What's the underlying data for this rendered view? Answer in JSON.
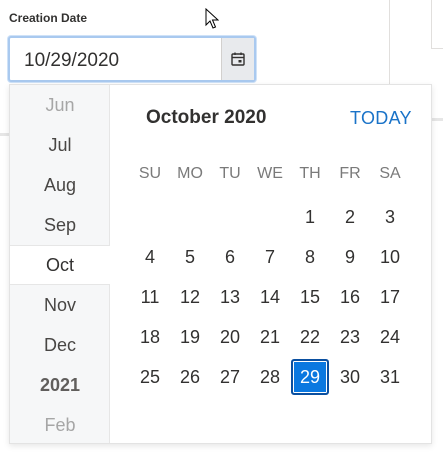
{
  "field": {
    "label": "Creation Date",
    "value": "10/29/2020",
    "button_icon": "calendar-icon"
  },
  "picker": {
    "month_strip": [
      {
        "label": "Jun",
        "state": "faded"
      },
      {
        "label": "Jul",
        "state": "normal"
      },
      {
        "label": "Aug",
        "state": "normal"
      },
      {
        "label": "Sep",
        "state": "normal"
      },
      {
        "label": "Oct",
        "state": "selected"
      },
      {
        "label": "Nov",
        "state": "normal"
      },
      {
        "label": "Dec",
        "state": "normal"
      },
      {
        "label": "2021",
        "state": "year"
      },
      {
        "label": "Feb",
        "state": "faded"
      }
    ],
    "title": "October 2020",
    "today_label": "TODAY",
    "weekdays": [
      "SU",
      "MO",
      "TU",
      "WE",
      "TH",
      "FR",
      "SA"
    ],
    "first_weekday_index": 4,
    "days_in_month": 31,
    "selected_day": 29
  },
  "colors": {
    "accent": "#0a78e0",
    "link": "#1a73c8",
    "focus_border": "#a9c9ef"
  }
}
